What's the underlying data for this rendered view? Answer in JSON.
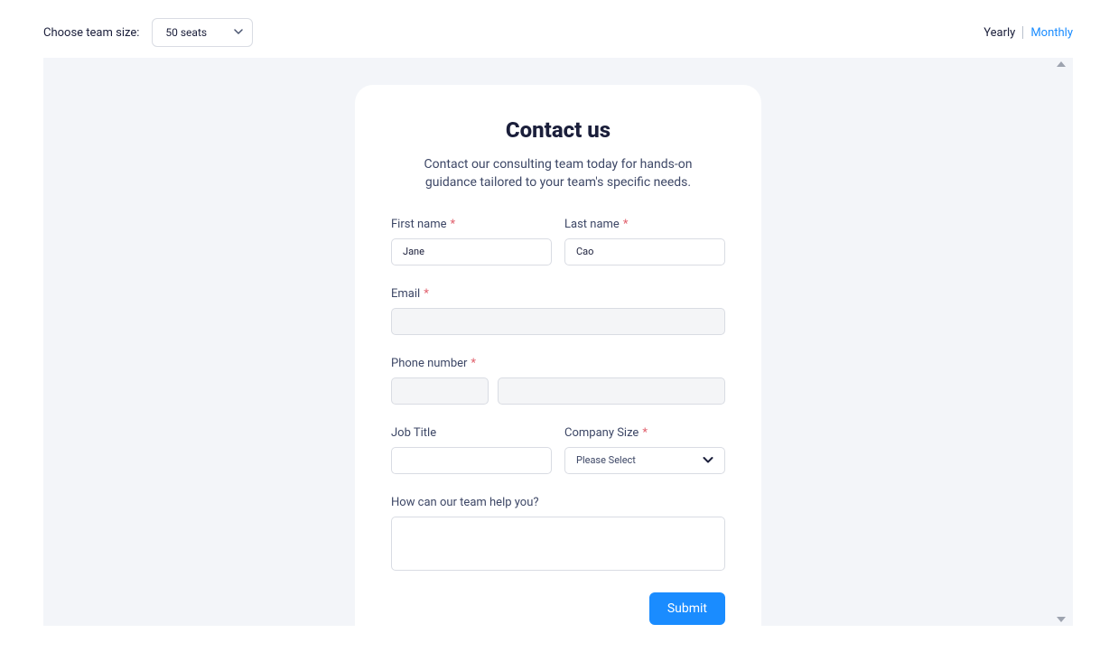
{
  "header": {
    "team_size_label": "Choose team size:",
    "team_size_value": "50 seats",
    "billing_yearly": "Yearly",
    "billing_monthly": "Monthly"
  },
  "form": {
    "title": "Contact us",
    "subtitle": "Contact our consulting team today for hands-on guidance tailored to your team's specific needs.",
    "first_name_label": "First name",
    "first_name_value": "Jane",
    "last_name_label": "Last name",
    "last_name_value": "Cao",
    "email_label": "Email",
    "email_value": "",
    "phone_label": "Phone number",
    "phone_value": "",
    "job_title_label": "Job Title",
    "job_title_value": "",
    "company_size_label": "Company Size",
    "company_size_value": "Please Select",
    "help_label": "How can our team help you?",
    "help_value": "",
    "submit_label": "Submit"
  }
}
